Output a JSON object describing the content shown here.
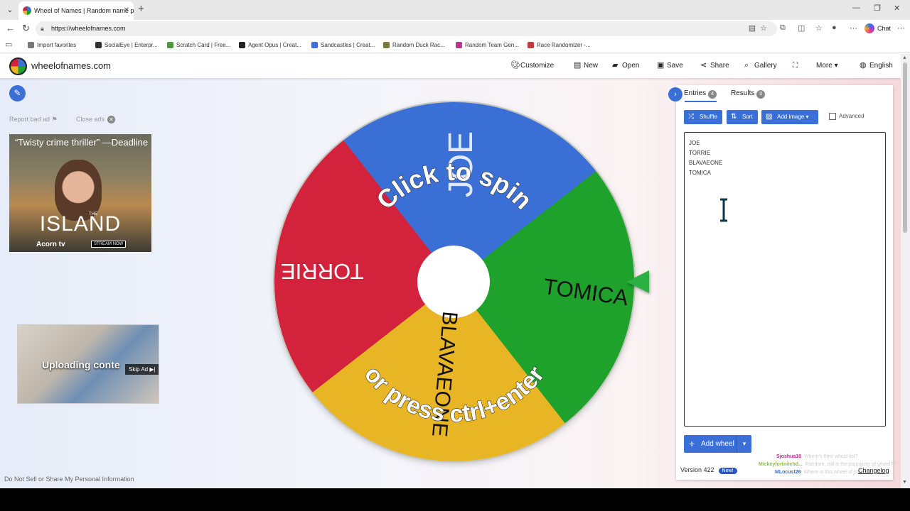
{
  "browser": {
    "tab_title": "Wheel of Names | Random name p",
    "url": "https://wheelofnames.com",
    "chat_label": "Chat",
    "bookmarks": [
      {
        "label": "Import favorites",
        "color": "#777777"
      },
      {
        "label": "SocialEye | Enterpr...",
        "color": "#333333"
      },
      {
        "label": "Scratch Card | Free...",
        "color": "#4a9a3a"
      },
      {
        "label": "Agent Opus | Creat...",
        "color": "#222222"
      },
      {
        "label": "Sandcastles | Creat...",
        "color": "#3a6fd8"
      },
      {
        "label": "Random Duck Rac...",
        "color": "#7a7a3a"
      },
      {
        "label": "Random Team Gen...",
        "color": "#b5378f"
      },
      {
        "label": "Race Randomizer -...",
        "color": "#c23a3a"
      }
    ]
  },
  "app": {
    "site_name": "wheelofnames.com",
    "menu": [
      {
        "label": "Customize",
        "icon": "palette-icon"
      },
      {
        "label": "New",
        "icon": "file-icon"
      },
      {
        "label": "Open",
        "icon": "folder-icon"
      },
      {
        "label": "Save",
        "icon": "save-icon"
      },
      {
        "label": "Share",
        "icon": "share-icon"
      },
      {
        "label": "Gallery",
        "icon": "search-icon"
      },
      {
        "label": "",
        "icon": "fullscreen-icon"
      },
      {
        "label": "More",
        "icon": "chevron-down-icon"
      },
      {
        "label": "English",
        "icon": "globe-icon"
      }
    ]
  },
  "left": {
    "report_ad": "Report bad ad",
    "close_ads": "Close ads",
    "ad1": {
      "quote": "“Twisty crime thriller” —Deadline",
      "title": "ISLAND",
      "the": "THE",
      "brand": "Acorn tv",
      "cta": "STREAM NOW"
    },
    "ad2": {
      "text": "Uploading conte",
      "skip": "Skip Ad ▶|"
    },
    "do_not_sell": "Do Not Sell or Share My Personal Information"
  },
  "wheel": {
    "labels": [
      "JOE",
      "TOMICA",
      "BLAVAEONE",
      "TORRIE"
    ],
    "colors": {
      "JOE": "#3a6fd6",
      "TOMICA": "#1ea22b",
      "BLAVAEONE": "#e8b524",
      "TORRIE": "#d3223b"
    },
    "spin_text_top": "Click to spin",
    "spin_text_bottom": "or press ctrl+enter"
  },
  "panel": {
    "tabs": {
      "entries": "Entries",
      "entries_count": "4",
      "results": "Results",
      "results_count": "0"
    },
    "buttons": {
      "shuffle": "Shuffle",
      "sort": "Sort",
      "add_image": "Add image",
      "advanced": "Advanced"
    },
    "entries": [
      "JOE",
      "TORRIE",
      "BLAVAEONE",
      "TOMICA"
    ],
    "add_wheel": "Add wheel",
    "version": "Version 422",
    "new_badge": "New!",
    "changelog": "Changelog",
    "feed": [
      {
        "user": "Sjoshua18",
        "color": "#c02a8e",
        "text": "Where's their wheel list?"
      },
      {
        "user": "Mickeyfortnitehd...",
        "color": "#8ac23a",
        "text": "Random, still is the popularity of wheel??"
      },
      {
        "user": "MLocust26",
        "color": "#3a6fd8",
        "text": "Where is this wheel of yours?"
      }
    ]
  }
}
